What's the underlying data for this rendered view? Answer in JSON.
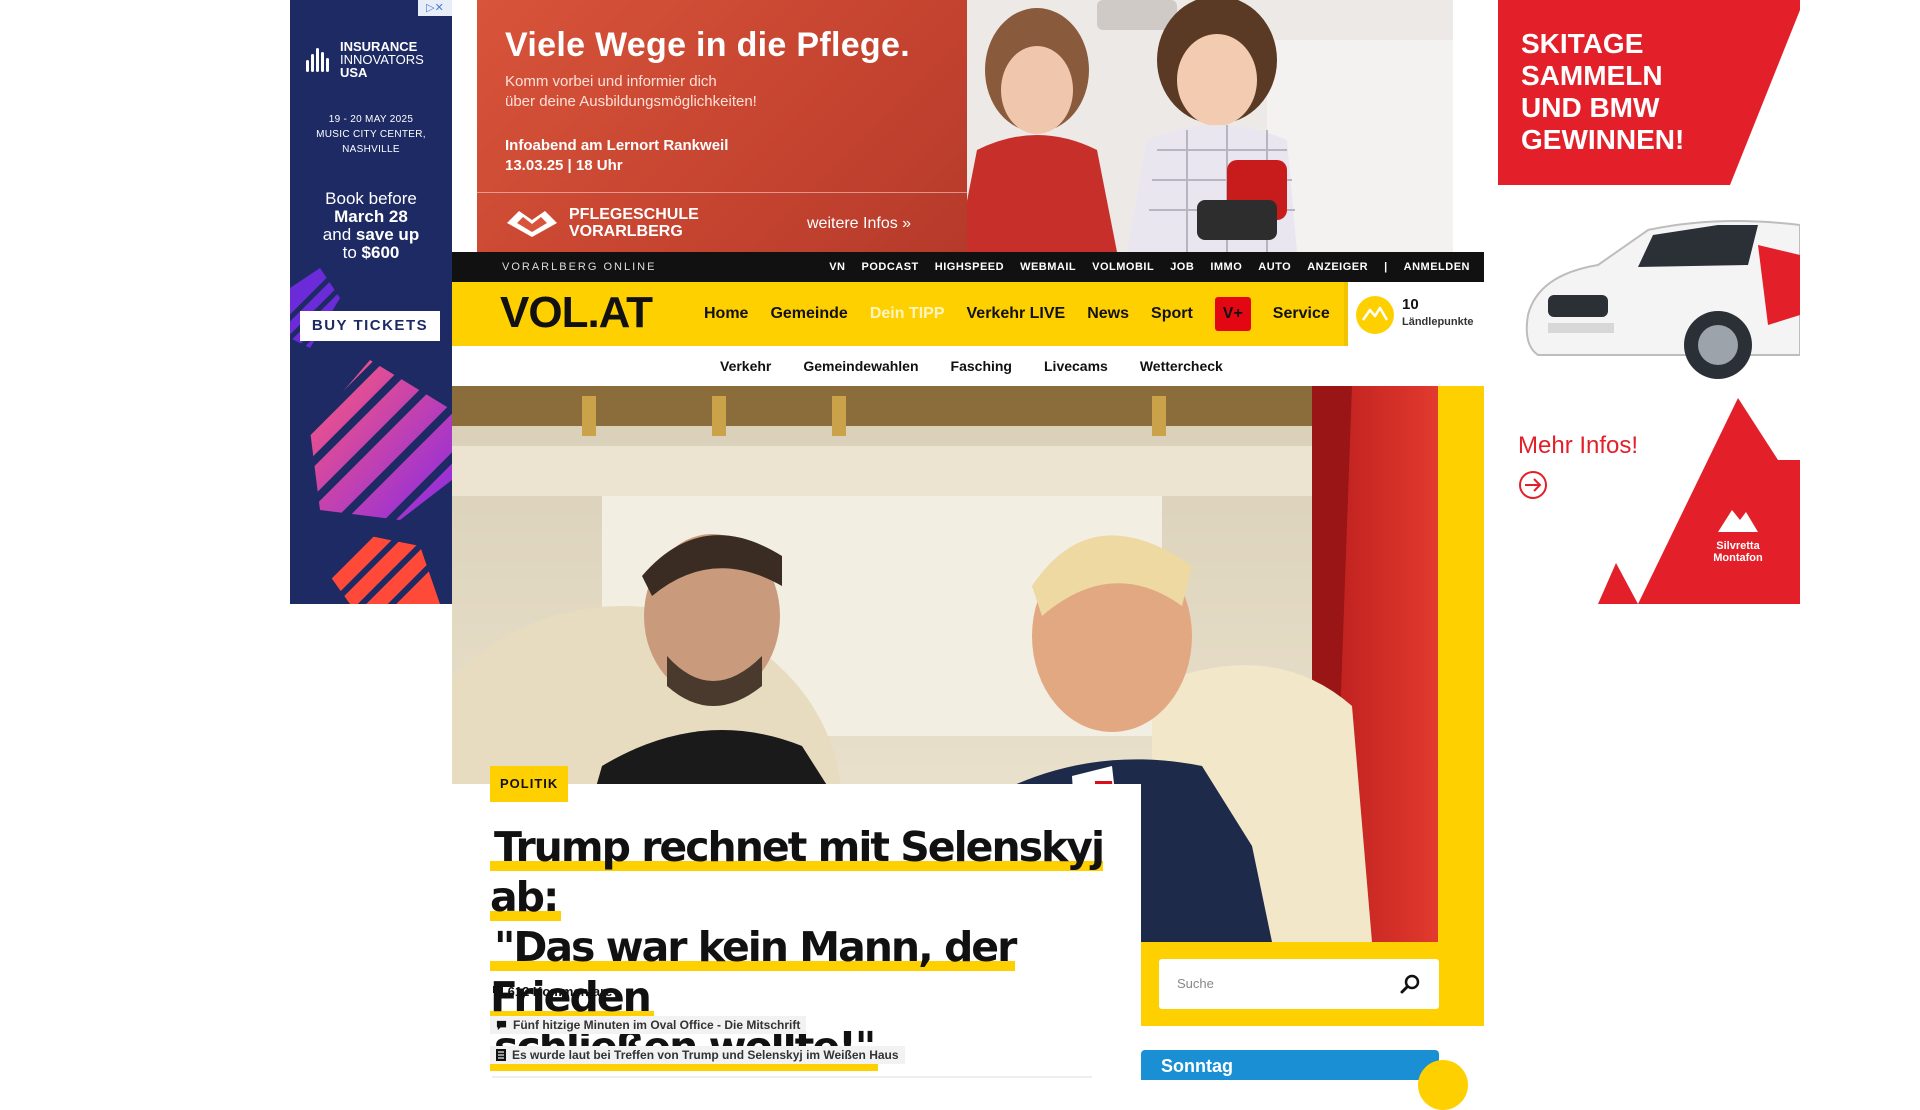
{
  "left_ad": {
    "adchoice": "▷✕",
    "logo_line1": "INSURANCE",
    "logo_line2": "INNOVATORS",
    "logo_line3": "USA",
    "dates_line1": "19 - 20 MAY 2025",
    "dates_line2": "MUSIC CITY CENTER,",
    "dates_line3": "NASHVILLE",
    "book_line1": "Book before",
    "book_line2": "March 28",
    "book_line3a": "and",
    "book_line3b": "save up",
    "book_line4a": "to",
    "book_line4b": "$600",
    "cta": "BUY TICKETS"
  },
  "top_ad": {
    "headline": "Viele Wege in die Pflege.",
    "sub_line1": "Komm vorbei und informier dich",
    "sub_line2": "über deine Ausbildungsmöglichkeiten!",
    "event_line1": "Infoabend am Lernort Rankweil",
    "event_line2": "13.03.25 | 18 Uhr",
    "school_line1": "PFLEGESCHULE",
    "school_line2": "VORARLBERG",
    "more": "weitere Infos »"
  },
  "right_ad": {
    "text_line1": "SKITAGE",
    "text_line2": "SAMMELN",
    "text_line3": "UND BMW",
    "text_line4": "GEWINNEN!",
    "more": "Mehr Infos!",
    "brand_line1": "Silvretta",
    "brand_line2": "Montafon"
  },
  "topbar": {
    "brand": "VORARLBERG ONLINE",
    "links": [
      "VN",
      "PODCAST",
      "HIGHSPEED",
      "WEBMAIL",
      "VOLMOBIL",
      "JOB",
      "IMMO",
      "AUTO",
      "ANZEIGER",
      "|",
      "ANMELDEN"
    ]
  },
  "mainnav": {
    "logo": "VOL.AT",
    "items": [
      "Home",
      "Gemeinde",
      "Dein TIPP",
      "Verkehr LIVE",
      "News",
      "Sport"
    ],
    "vplus": "V+",
    "service": "Service",
    "points_value": "10",
    "points_label": "Ländlepunkte"
  },
  "subnav": {
    "items": [
      "Verkehr",
      "Gemeindewahlen",
      "Fasching",
      "Livecams",
      "Wettercheck"
    ]
  },
  "article": {
    "tag": "POLITIK",
    "title_line1": "Trump rechnet mit Selenskyj ab:",
    "title_line2": "\"Das war kein Mann, der Frieden",
    "title_line3": "schließen wollte!\"",
    "comments": "612 Kommentare",
    "related": [
      "Fünf hitzige Minuten im Oval Office - Die Mitschrift",
      "Es wurde laut bei Treffen von Trump und Selenskyj im Weißen Haus"
    ]
  },
  "search": {
    "placeholder": "Suche"
  },
  "weather": {
    "day": "Sonntag"
  }
}
